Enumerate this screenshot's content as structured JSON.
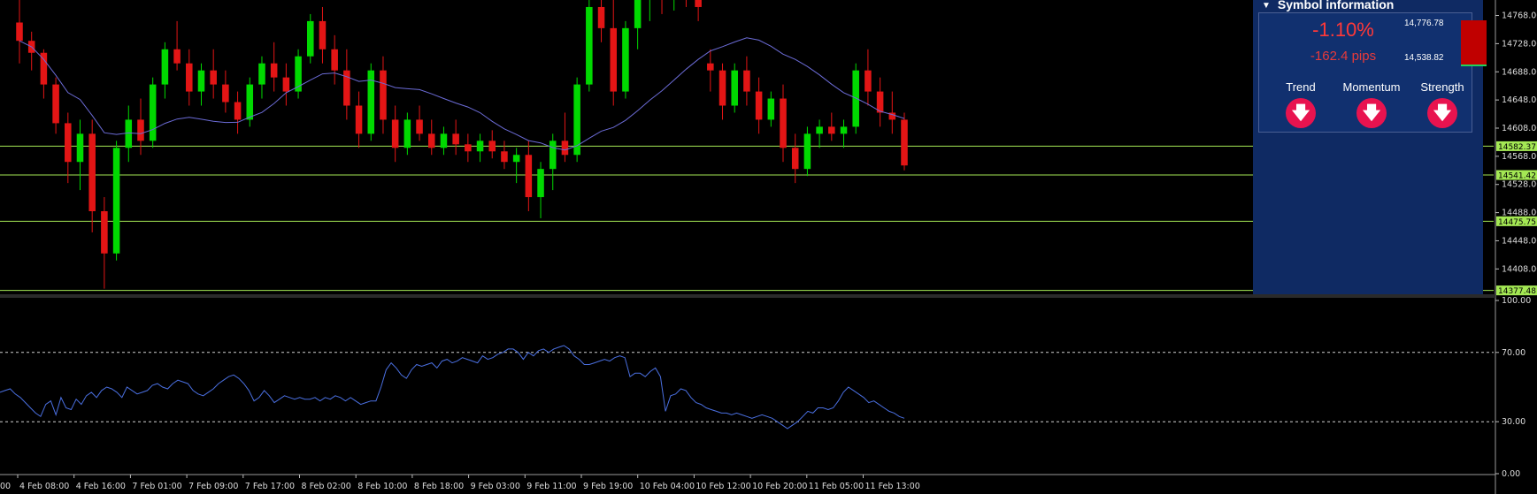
{
  "chart_data": [
    {
      "type": "candlestick",
      "title": "",
      "x_tick_labels": [
        "4 Feb 08:00",
        "4 Feb 16:00",
        "7 Feb 01:00",
        "7 Feb 09:00",
        "7 Feb 17:00",
        "8 Feb 02:00",
        "8 Feb 10:00",
        "8 Feb 18:00",
        "9 Feb 03:00",
        "9 Feb 11:00",
        "9 Feb 19:00",
        "10 Feb 04:00",
        "10 Feb 12:00",
        "10 Feb 20:00",
        "11 Feb 05:00",
        "11 Feb 13:00"
      ],
      "x_tick_label_leading_fragment": "00",
      "y_tick_labels": [
        "14768.00",
        "14728.00",
        "14688.00",
        "14648.00",
        "14608.00",
        "14568.00",
        "14528.00",
        "14488.00",
        "14448.00",
        "14408.00"
      ],
      "ylim": [
        14372,
        14790
      ],
      "horizontal_levels": [
        14582.37,
        14541.42,
        14475.75,
        14377.48
      ],
      "level_labels": [
        "14582.37",
        "14541.42",
        "14475.75",
        "14377.48"
      ],
      "bull_color": "#00d900",
      "bear_color": "#e31515",
      "moving_average_color": "#6b6bd6",
      "candles": [
        [
          14758,
          14790,
          14700,
          14732
        ],
        [
          14732,
          14745,
          14690,
          14715
        ],
        [
          14715,
          14720,
          14650,
          14670
        ],
        [
          14670,
          14680,
          14600,
          14615
        ],
        [
          14615,
          14630,
          14530,
          14560
        ],
        [
          14560,
          14620,
          14520,
          14600
        ],
        [
          14600,
          14620,
          14460,
          14490
        ],
        [
          14490,
          14510,
          14380,
          14430
        ],
        [
          14430,
          14590,
          14420,
          14580
        ],
        [
          14580,
          14640,
          14560,
          14620
        ],
        [
          14620,
          14650,
          14570,
          14590
        ],
        [
          14590,
          14680,
          14580,
          14670
        ],
        [
          14670,
          14730,
          14650,
          14720
        ],
        [
          14720,
          14760,
          14690,
          14700
        ],
        [
          14700,
          14720,
          14640,
          14660
        ],
        [
          14660,
          14700,
          14640,
          14690
        ],
        [
          14690,
          14720,
          14650,
          14670
        ],
        [
          14670,
          14690,
          14630,
          14645
        ],
        [
          14645,
          14660,
          14600,
          14620
        ],
        [
          14620,
          14680,
          14610,
          14670
        ],
        [
          14670,
          14710,
          14650,
          14700
        ],
        [
          14700,
          14730,
          14660,
          14680
        ],
        [
          14680,
          14700,
          14640,
          14660
        ],
        [
          14660,
          14720,
          14650,
          14710
        ],
        [
          14710,
          14770,
          14700,
          14760
        ],
        [
          14760,
          14780,
          14700,
          14720
        ],
        [
          14720,
          14740,
          14670,
          14690
        ],
        [
          14690,
          14720,
          14620,
          14640
        ],
        [
          14640,
          14660,
          14580,
          14600
        ],
        [
          14600,
          14700,
          14590,
          14690
        ],
        [
          14690,
          14710,
          14600,
          14620
        ],
        [
          14620,
          14640,
          14560,
          14580
        ],
        [
          14580,
          14630,
          14570,
          14620
        ],
        [
          14620,
          14640,
          14590,
          14600
        ],
        [
          14600,
          14620,
          14570,
          14580
        ],
        [
          14580,
          14610,
          14570,
          14600
        ],
        [
          14600,
          14620,
          14570,
          14585
        ],
        [
          14585,
          14600,
          14560,
          14575
        ],
        [
          14575,
          14600,
          14560,
          14590
        ],
        [
          14590,
          14605,
          14565,
          14575
        ],
        [
          14575,
          14590,
          14550,
          14560
        ],
        [
          14560,
          14580,
          14530,
          14570
        ],
        [
          14570,
          14590,
          14490,
          14510
        ],
        [
          14510,
          14560,
          14480,
          14550
        ],
        [
          14550,
          14600,
          14520,
          14590
        ],
        [
          14590,
          14630,
          14560,
          14570
        ],
        [
          14570,
          14680,
          14560,
          14670
        ],
        [
          14670,
          14790,
          14660,
          14780
        ],
        [
          14780,
          14800,
          14730,
          14750
        ],
        [
          14750,
          14790,
          14640,
          14660
        ],
        [
          14660,
          14760,
          14650,
          14750
        ],
        [
          14750,
          14800,
          14720,
          14790
        ],
        [
          14790,
          14810,
          14760,
          14800
        ],
        [
          14800,
          14810,
          14770,
          14790
        ],
        [
          14790,
          14810,
          14775,
          14805
        ],
        [
          14805,
          14820,
          14780,
          14790
        ],
        [
          14790,
          14800,
          14760,
          14780
        ],
        [
          14700,
          14720,
          14660,
          14690
        ],
        [
          14690,
          14700,
          14620,
          14640
        ],
        [
          14640,
          14700,
          14630,
          14690
        ],
        [
          14690,
          14710,
          14640,
          14660
        ],
        [
          14660,
          14680,
          14600,
          14620
        ],
        [
          14620,
          14660,
          14610,
          14650
        ],
        [
          14650,
          14670,
          14560,
          14580
        ],
        [
          14580,
          14600,
          14530,
          14550
        ],
        [
          14550,
          14610,
          14540,
          14600
        ],
        [
          14600,
          14620,
          14580,
          14610
        ],
        [
          14610,
          14630,
          14590,
          14600
        ],
        [
          14600,
          14620,
          14580,
          14610
        ],
        [
          14610,
          14700,
          14600,
          14690
        ],
        [
          14690,
          14720,
          14640,
          14660
        ],
        [
          14660,
          14680,
          14610,
          14630
        ],
        [
          14630,
          14660,
          14600,
          14620
        ],
        [
          14620,
          14630,
          14548,
          14555
        ]
      ]
    },
    {
      "type": "line",
      "title": "",
      "y_tick_labels": [
        "100.00",
        "70.00",
        "30.00",
        "0.00"
      ],
      "ylim": [
        0,
        100
      ],
      "reference_levels": [
        70,
        30
      ],
      "line_color": "#4a6fe0",
      "values": [
        47,
        48,
        49,
        46,
        44,
        41,
        38,
        35,
        33,
        40,
        42,
        34,
        44,
        38,
        37,
        43,
        40,
        45,
        47,
        44,
        48,
        50,
        49,
        47,
        44,
        50,
        48,
        46,
        47,
        48,
        51,
        52,
        50,
        49,
        52,
        54,
        53,
        52,
        48,
        46,
        45,
        47,
        49,
        52,
        54,
        56,
        57,
        55,
        52,
        48,
        42,
        44,
        48,
        45,
        41,
        43,
        45,
        44,
        43,
        44,
        43,
        43,
        44,
        42,
        44,
        43,
        45,
        44,
        42,
        44,
        42,
        40,
        41,
        42,
        42,
        50,
        60,
        64,
        61,
        57,
        55,
        60,
        63,
        62,
        63,
        64,
        61,
        65,
        66,
        64,
        65,
        67,
        66,
        65,
        64,
        68,
        66,
        67,
        69,
        70,
        72,
        72,
        70,
        66,
        70,
        68,
        71,
        72,
        70,
        72,
        73,
        74,
        72,
        68,
        66,
        63,
        63,
        64,
        65,
        66,
        65,
        67,
        68,
        67,
        56,
        58,
        58,
        56,
        59,
        61,
        56,
        36,
        45,
        46,
        49,
        48,
        44,
        41,
        40,
        38,
        37,
        36,
        35,
        35,
        34,
        35,
        34,
        33,
        32,
        33,
        34,
        33,
        32,
        30,
        28,
        26,
        28,
        30,
        33,
        36,
        35,
        38,
        38,
        37,
        38,
        42,
        47,
        50,
        48,
        46,
        44,
        41,
        42,
        40,
        38,
        36,
        35,
        33,
        32
      ]
    }
  ],
  "symbol_panel": {
    "title": "Symbol information",
    "change_percent": "-1.10%",
    "change_pips": "-162.4 pips",
    "range_high": "14,776.78",
    "range_low": "14,538.82",
    "indicators": [
      {
        "label": "Trend",
        "direction": "down",
        "icon": "arrow-down-icon"
      },
      {
        "label": "Momentum",
        "direction": "down",
        "icon": "arrow-down-icon"
      },
      {
        "label": "Strength",
        "direction": "down",
        "icon": "arrow-down-icon"
      }
    ],
    "panel_color": "#0f2a63",
    "signal_color": "#e8134f"
  }
}
